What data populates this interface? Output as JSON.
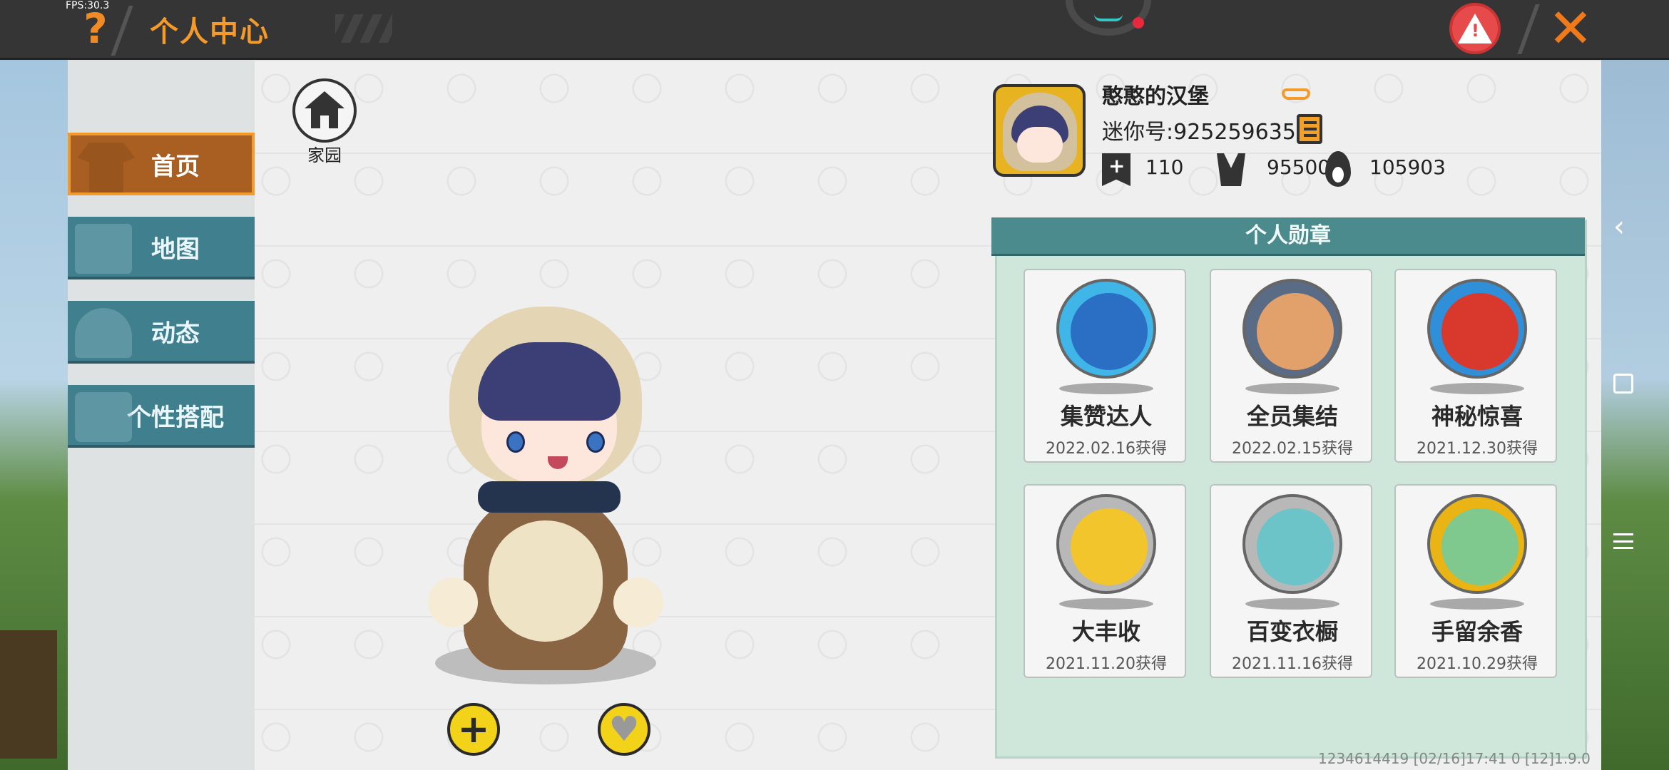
{
  "topbar": {
    "fps": "FPS:30.3",
    "help_symbol": "?",
    "title": "个人中心",
    "close_symbol": "✕",
    "report_symbol": "!"
  },
  "sidebar": {
    "items": [
      {
        "label": "首页",
        "icon": "shirt-icon",
        "active": true
      },
      {
        "label": "地图",
        "icon": "picture-icon",
        "active": false
      },
      {
        "label": "动态",
        "icon": "bell-icon",
        "active": false
      },
      {
        "label": "个性搭配",
        "icon": "robot-icon",
        "active": false
      }
    ]
  },
  "home": {
    "label": "家园"
  },
  "actions": {
    "add_symbol": "+",
    "like_symbol": "♥"
  },
  "profile": {
    "nickname": "憨憨的汉堡",
    "mini_id": "迷你号:925259635",
    "stats": {
      "bookmarks": "110",
      "likes": "95500",
      "heat": "105903"
    }
  },
  "medals": {
    "header": "个人勋章",
    "items": [
      {
        "name": "集赞达人",
        "date": "2022.02.16获得",
        "ring": "#3fb5e8",
        "inner": "#2b6fc4"
      },
      {
        "name": "全员集结",
        "date": "2022.02.15获得",
        "ring": "#5a6b85",
        "inner": "#e2a06a"
      },
      {
        "name": "神秘惊喜",
        "date": "2021.12.30获得",
        "ring": "#2f8fd8",
        "inner": "#d8392c"
      },
      {
        "name": "大丰收",
        "date": "2021.11.20获得",
        "ring": "#b8b8b8",
        "inner": "#f2c52c"
      },
      {
        "name": "百变衣橱",
        "date": "2021.11.16获得",
        "ring": "#b8b8b8",
        "inner": "#6cc4c9"
      },
      {
        "name": "手留余香",
        "date": "2021.10.29获得",
        "ring": "#e9b414",
        "inner": "#7fc98e"
      }
    ]
  },
  "footer": {
    "debug": "1234614419    [02/16]17:41 0   [12]1.9.0"
  },
  "colors": {
    "accent": "#f39a2b",
    "sidebar": "#3f7f8e",
    "medal_header": "#4c8b8d"
  }
}
